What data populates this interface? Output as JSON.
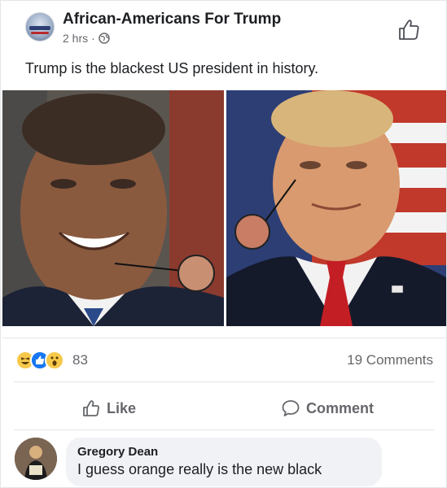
{
  "post": {
    "page_name": "African-Americans For Trump",
    "timestamp": "2 hrs",
    "separator": "·",
    "privacy_icon": "globe-icon",
    "caption": "Trump is the blackest US president in history."
  },
  "photo": {
    "description_icon": "comparison-photo",
    "swatch_color": "#c98f73",
    "trump_swatch_color": "#c87d64"
  },
  "reactions": {
    "icons": [
      "haha-reaction-icon",
      "like-reaction-icon",
      "wow-reaction-icon"
    ],
    "count": "83",
    "comments_label": "19 Comments"
  },
  "actions": {
    "like_label": "Like",
    "comment_label": "Comment"
  },
  "comment": {
    "author": "Gregory Dean",
    "text": "I guess orange really is the new black"
  },
  "colors": {
    "text_primary": "#1c1e21",
    "text_secondary": "#65676b",
    "like_blue": "#1877f2",
    "divider": "#e4e6ea",
    "comment_bg": "#f0f2f5"
  }
}
